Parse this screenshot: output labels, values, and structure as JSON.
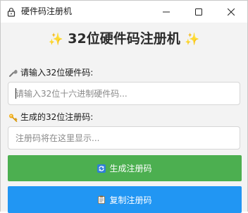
{
  "window": {
    "title": "硬件码注册机",
    "controls": [
      "minimize-icon",
      "maximize-icon",
      "close-icon"
    ]
  },
  "heading": {
    "spark_left": "✨",
    "title": "32位硬件码注册机",
    "spark_right": "✨"
  },
  "hardware_field": {
    "label": "请输入32位硬件码:",
    "icon": "wrench-icon",
    "value": "",
    "placeholder": "请输入32位十六进制硬件码..."
  },
  "register_field": {
    "label": "生成的32位注册码:",
    "icon": "key-icon",
    "value": "",
    "placeholder": "注册码将在这里显示..."
  },
  "buttons": {
    "generate_label": "生成注册码",
    "generate_icon": "refresh-icon",
    "copy_label": "复制注册码",
    "copy_icon": "clipboard-icon"
  },
  "colors": {
    "generate_button": "#4caf50",
    "copy_button": "#2196f3",
    "sparkle": "#f2b01e"
  }
}
